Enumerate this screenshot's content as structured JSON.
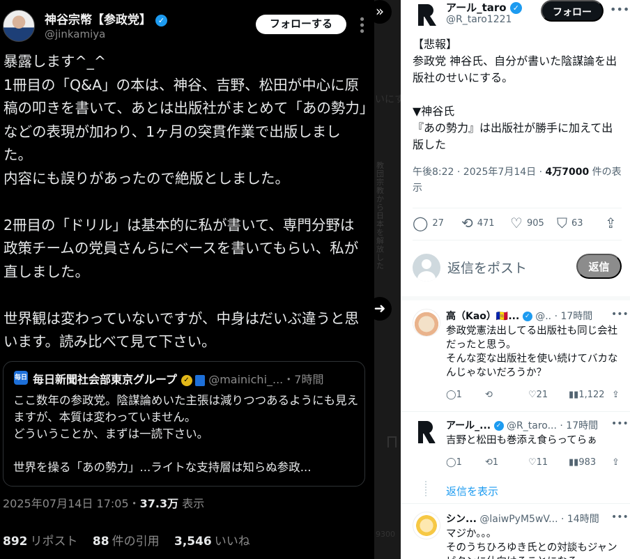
{
  "left_post": {
    "author_name": "神谷宗幣【参政党】",
    "verified_mark": "✓",
    "handle": "@jinkamiya",
    "follow_label": "フォローする",
    "more_icon": "more-icon",
    "body": "暴露します^_^\n1冊目の「Q&A」の本は、神谷、吉野、松田が中心に原稿の叩きを書いて、あとは出版社がまとめて「あの勢力」などの表現が加わり、1ヶ月の突貫作業で出版しました。\n内容にも誤りがあったので絶版としました。\n\n2冊目の「ドリル」は基本的に私が書いて、専門分野は政策チームの党員さんらにベースを書いてもらい、私が直しました。\n\n世界観は変わっていないですが、中身はだいぶ違うと思います。読み比べて見て下さい。",
    "quote": {
      "logo_text": "毎日",
      "name": "毎日新聞社会部東京グループ",
      "gold_mark": "✓",
      "handle": "@mainichi_...",
      "time": "・7時間",
      "text": "ここ数年の参政党。陰謀論めいた主張は減りつつあるようにも見えますが、本質は変わっていません。\nどういうことか、まずは一読下さい。\n\n世界を操る「あの勢力」...ライトな支持層は知らぬ参政..."
    },
    "date": "2025年07月14日 17:05・",
    "views_count": "37.3万",
    "views_label": " 表示",
    "reposts_count": "892",
    "reposts_label": "リポスト",
    "quotes_count": "88",
    "quotes_label": "件の引用",
    "likes_count": "3,546",
    "likes_label": "いいね"
  },
  "strip": {
    "vertical_text": "教団宗教から日本を解放した",
    "fragment_top": "いにす",
    "fragment_bottom": "9300"
  },
  "nav": {
    "collapse_glyph": "»",
    "next_glyph": "➜"
  },
  "right_post": {
    "author_name": "アール_taro",
    "verified_mark": "✓",
    "handle": "@R_taro1221",
    "follow_label": "フォロー",
    "body": "【悲報】\n参政党 神谷氏、自分が書いた陰謀論を出版社のせいにする。\n\n▼神谷氏\n『あの勢力』は出版社が勝手に加えて出版した",
    "meta_time": "午後8:22 · 2025年7月14日 · ",
    "meta_views": "4万7000",
    "meta_views_label": " 件の表示",
    "replies": "27",
    "reposts": "471",
    "likes": "905",
    "bookmarks": "63",
    "reply_placeholder": "返信をポスト",
    "reply_button": "返信"
  },
  "comments": [
    {
      "name": "高（Kao）🇦🇩...",
      "handle": "@..",
      "time": "· 17時間",
      "text": "参政党憲法出してる出版社も同じ会社だったと思う。\nそんな変な出版社を使い続けてバカなんじゃないだろうか？",
      "replies": "1",
      "reposts": "",
      "likes": "21",
      "views": "1,122"
    },
    {
      "name": "アール_...",
      "handle": "@R_taro...",
      "time": "· 17時間",
      "text": "吉野と松田も巻添え食らってらぁ",
      "replies": "1",
      "reposts": "1",
      "likes": "11",
      "views": "983"
    },
    {
      "name": "シン...",
      "handle": "@laiwPyM5wV...",
      "time": "· 14時間",
      "text": "マジか。。。\nそのうちひろゆき氏との対談もジャンピタンに仕向けることになる",
      "replies": "",
      "reposts": "",
      "likes": "",
      "views": ""
    }
  ],
  "show_replies": "返信を表示",
  "icons": {
    "reply": "💬",
    "repost": "⟲",
    "like": "♡",
    "bookmark": "🔖",
    "share": "⇪",
    "views": "📊"
  },
  "colors": {
    "accent": "#1d9bf0",
    "gold": "#e2b719",
    "dark_bg": "#000000"
  }
}
